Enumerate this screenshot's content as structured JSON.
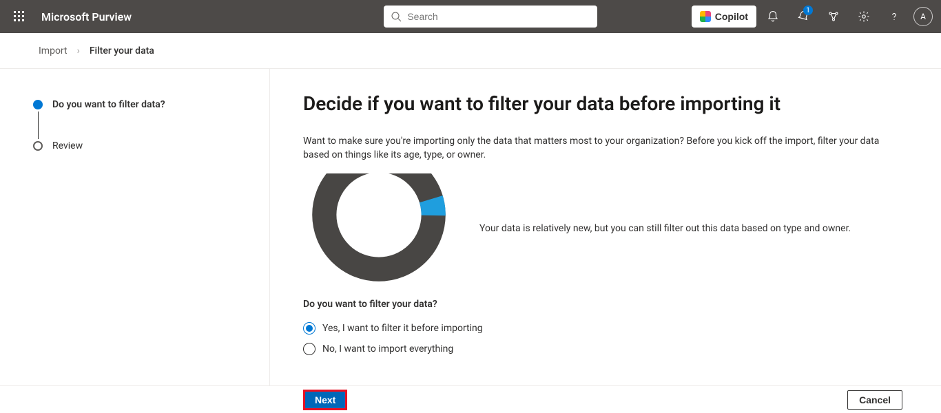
{
  "header": {
    "app_name": "Microsoft Purview",
    "search_placeholder": "Search",
    "copilot_label": "Copilot",
    "avatar_initial": "A",
    "badge_count": "1"
  },
  "breadcrumb": {
    "items": [
      "Import",
      "Filter your data"
    ]
  },
  "sidebar": {
    "steps": [
      {
        "label": "Do you want to filter data?",
        "active": true
      },
      {
        "label": "Review",
        "active": false
      }
    ]
  },
  "main": {
    "title": "Decide if you want to filter your data before importing it",
    "description": "Want to make sure you're importing only the data that matters most to your organization? Before you kick off the import, filter your data based on things like its age, type, or owner.",
    "chart_note": "Your data is relatively new, but you can still filter out this data based on type and owner.",
    "question": "Do you want to filter your data?",
    "options": [
      {
        "label": "Yes, I want to filter it before importing",
        "selected": true
      },
      {
        "label": "No, I want to import everything",
        "selected": false
      }
    ]
  },
  "footer": {
    "next": "Next",
    "cancel": "Cancel"
  },
  "chart_data": {
    "type": "pie",
    "title": "",
    "series": [
      {
        "name": "primary",
        "value": 95,
        "color": "#484644"
      },
      {
        "name": "accent",
        "value": 5,
        "color": "#1f9ede"
      }
    ]
  },
  "colors": {
    "topbar": "#4d4a48",
    "accent": "#0078d4",
    "highlight_border": "#e81123"
  }
}
